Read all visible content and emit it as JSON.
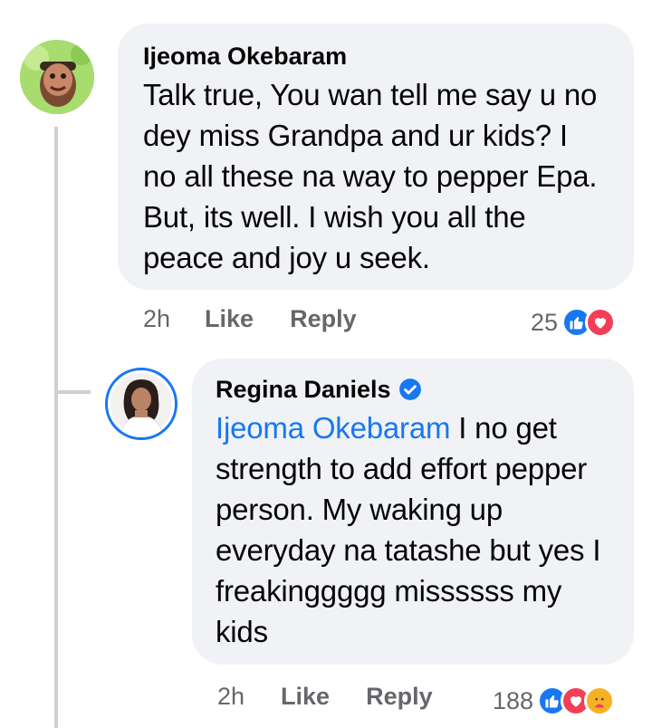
{
  "comment": {
    "author": "Ijeoma Okebaram",
    "text": "Talk true, You wan tell me say u no dey miss Grandpa and ur kids? I no all these na way to pepper Epa. But, its well. I wish you all the peace and joy u seek.",
    "time": "2h",
    "like_label": "Like",
    "reply_label": "Reply",
    "reaction_count": "25",
    "reactions": [
      "like-icon",
      "love-icon"
    ]
  },
  "reply": {
    "author": "Regina Daniels",
    "verified": true,
    "mention": "Ijeoma Okebaram",
    "text": "I no get strength to add effort pepper person. My waking up everyday na tatashe but yes I freakinggggg missssss my kids",
    "time": "2h",
    "like_label": "Like",
    "reply_label": "Reply",
    "reaction_count": "188",
    "reactions": [
      "like-icon",
      "love-icon",
      "care-icon"
    ]
  },
  "colors": {
    "bubble": "#f0f2f5",
    "link": "#1877f2",
    "meta": "#65676b",
    "like": "#1877f2",
    "love": "#f33e58",
    "care": "#f7b125"
  }
}
